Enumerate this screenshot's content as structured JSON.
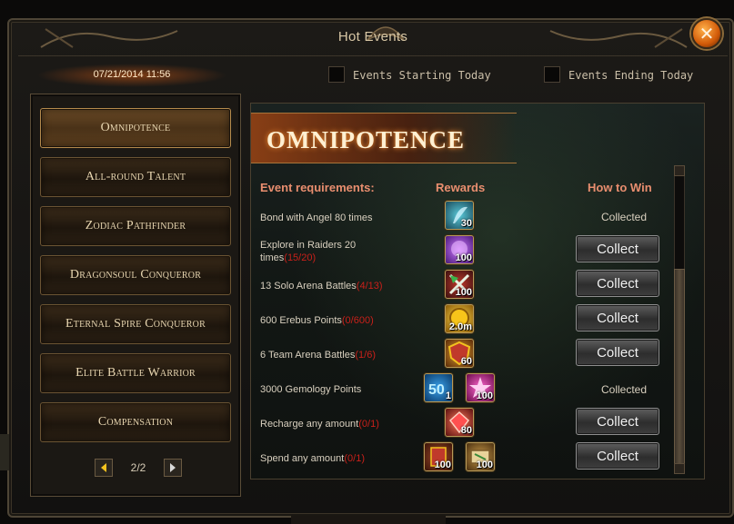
{
  "window": {
    "title": "Hot Events",
    "close_label": "✕"
  },
  "date": "07/21/2014 11:56",
  "filters": [
    {
      "label": "Events Starting Today",
      "checked": false
    },
    {
      "label": "Events Ending Today",
      "checked": false
    }
  ],
  "sidebar": {
    "items": [
      {
        "label": "Omnipotence",
        "active": true
      },
      {
        "label": "All-round Talent",
        "active": false
      },
      {
        "label": "Zodiac Pathfinder",
        "active": false
      },
      {
        "label": "Dragonsoul Conqueror",
        "active": false
      },
      {
        "label": "Eternal Spire Conqueror",
        "active": false
      },
      {
        "label": "Elite Battle Warrior",
        "active": false
      },
      {
        "label": "Compensation",
        "active": false
      }
    ],
    "page": "2/2"
  },
  "event": {
    "banner": "OMNIPOTENCE",
    "headers": {
      "requirements": "Event requirements:",
      "rewards": "Rewards",
      "how_to_win": "How to Win"
    },
    "rows": [
      {
        "req": "Bond with Angel 80 times",
        "progress": "",
        "rewards": [
          {
            "icon": "angel-feather-icon",
            "qty": "30"
          }
        ],
        "status": "Collected"
      },
      {
        "req": "Explore in Raiders 20 times",
        "progress": "(15/20)",
        "rewards": [
          {
            "icon": "purple-orb-icon",
            "qty": "100"
          }
        ],
        "status": "Collect"
      },
      {
        "req": "13 Solo Arena Battles",
        "progress": "(4/13)",
        "rewards": [
          {
            "icon": "crossed-swords-icon",
            "qty": "100"
          }
        ],
        "status": "Collect"
      },
      {
        "req": "600 Erebus Points",
        "progress": "(0/600)",
        "rewards": [
          {
            "icon": "gold-coin-icon",
            "qty": "2.0m"
          }
        ],
        "status": "Collect"
      },
      {
        "req": "6 Team Arena Battles",
        "progress": "(1/6)",
        "rewards": [
          {
            "icon": "shield-icon",
            "qty": "60"
          }
        ],
        "status": "Collect"
      },
      {
        "req": "3000 Gemology Points",
        "progress": "",
        "rewards": [
          {
            "icon": "gem-badge-icon",
            "qty": "1"
          },
          {
            "icon": "pink-star-icon",
            "qty": "100"
          }
        ],
        "status": "Collected"
      },
      {
        "req": "Recharge any amount",
        "progress": "(0/1)",
        "rewards": [
          {
            "icon": "red-gem-icon",
            "qty": "80"
          }
        ],
        "status": "Collect"
      },
      {
        "req": "Spend any amount",
        "progress": "(0/1)",
        "rewards": [
          {
            "icon": "scroll-book-icon",
            "qty": "100"
          },
          {
            "icon": "map-scroll-icon",
            "qty": "100"
          }
        ],
        "status": "Collect"
      }
    ]
  },
  "colors": {
    "accent": "#d25a08",
    "progress": "#c8201a",
    "header": "#e98e6f"
  }
}
